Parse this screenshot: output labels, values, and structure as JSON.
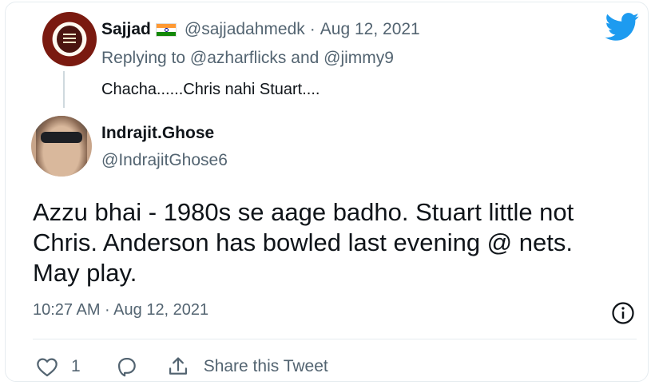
{
  "parent_tweet": {
    "author_name": "Sajjad",
    "author_handle": "@sajjadahmedk",
    "separator": "·",
    "date": "Aug 12, 2021",
    "replying_to_prefix": "Replying to",
    "replying_to_users": [
      "@azharflicks",
      "@jimmy9"
    ],
    "replying_to_joiner": "and",
    "text": "Chacha......Chris nahi Stuart...."
  },
  "main_tweet": {
    "author_name": "Indrajit.Ghose",
    "author_handle": "@IndrajitGhose6",
    "text": "Azzu bhai - 1980s se aage badho. Stuart little not Chris. Anderson has bowled last evening @ nets. May play.",
    "timestamp": "10:27 AM · Aug 12, 2021"
  },
  "actions": {
    "like_count": "1",
    "share_label": "Share this Tweet"
  },
  "icons": {
    "brand": "twitter-bird-icon",
    "info": "info-icon",
    "like": "heart-icon",
    "reply": "reply-bubble-icon",
    "share": "share-icon",
    "flag": "india-flag-icon"
  },
  "colors": {
    "twitter_blue": "#1d9bf0",
    "secondary_text": "#536471",
    "primary_text": "#0f1419"
  }
}
